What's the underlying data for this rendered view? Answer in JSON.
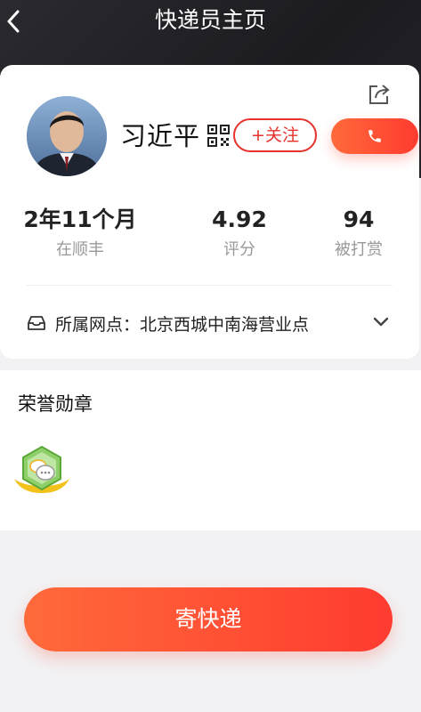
{
  "nav": {
    "title": "快递员主页",
    "back_icon": "chevron-left-icon"
  },
  "profile": {
    "name": "习近平",
    "follow_label": "+关注",
    "qr_icon": "qr-code-icon",
    "call_icon": "phone-icon",
    "share_icon": "share-icon"
  },
  "stats": [
    {
      "value": "2年11个月",
      "label": "在顺丰"
    },
    {
      "value": "4.92",
      "label": "评分"
    },
    {
      "value": "94",
      "label": "被打赏"
    }
  ],
  "branch": {
    "text": "所属网点：北京西城中南海营业点",
    "icon": "inbox-icon",
    "expand_icon": "chevron-down-icon"
  },
  "honor": {
    "title": "荣誉勋章",
    "badge_icon": "chat-medal-icon"
  },
  "action": {
    "send_label": "寄快递"
  },
  "colors": {
    "accent": "#ff3b30",
    "header_bg": "#1f1f24"
  }
}
